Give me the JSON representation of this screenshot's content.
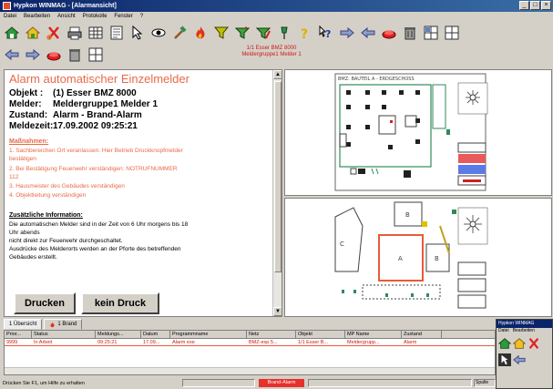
{
  "window": {
    "title": "Hypkon WINMAG - [Alarmansicht]",
    "controls": [
      "_",
      "□",
      "×"
    ]
  },
  "menu": {
    "items": [
      "Datei",
      "Bearbeiten",
      "Ansicht",
      "Protokolle",
      "Fenster",
      "?"
    ]
  },
  "toolbar": {
    "icons": [
      "home-icon",
      "home-alt-icon",
      "scissors-icon",
      "printer-icon",
      "grid-icon",
      "list-icon",
      "pointer-icon",
      "eye-icon",
      "hammer-icon",
      "fire-icon",
      "filter-icon",
      "filter-up-icon",
      "filter-edit-icon",
      "pin-icon",
      "help-icon",
      "context-help-icon",
      "arrow-right-icon",
      "arrow-left-icon",
      "reset-icon",
      "trash-icon",
      "layout-icon",
      "screen-icon"
    ],
    "row2_icons": [
      "back-icon",
      "forward-icon",
      "reset-icon",
      "trash-icon",
      "layout-icon"
    ],
    "alarm_summary_line1": "1/1 Esser BMZ 8000",
    "alarm_summary_line2": "Meldergruppe1 Melder 1"
  },
  "alarm": {
    "title": "Alarm automatischer Einzelmelder",
    "fields": [
      {
        "key": "Objekt :",
        "value": "(1)  Esser BMZ 8000"
      },
      {
        "key": "Melder:",
        "value": "Meldergruppe1 Melder 1"
      },
      {
        "key": "Zustand:",
        "value": "Alarm - Brand-Alarm"
      },
      {
        "key": "Meldezeit:",
        "value": "17.09.2002 09:25:21"
      }
    ],
    "measures_heading": "Maßnahmen:",
    "measures": [
      "1. Sachbereichen Ort veranlassen. Hier Betrieb Druckknopfmelder",
      "   bestätigen",
      "2. Bei Bestätigung Feuerwehr verständigen: NOTRUFNUMMER",
      "   112",
      "3. Hausmeister des Gebäudes verständigen",
      "4. Objektleitung verständigen"
    ],
    "extra_heading": "Zusätzliche Information:",
    "extra_lines": [
      "Die automatischen Melder sind in der Zeit von 6 Uhr morgens bis 18",
      "Uhr abends",
      "nicht direkt zur Feuerwehr durchgeschaltet.",
      "Ausdrücke des Melderorts werden an der Pforte des betreffenden",
      "Gebäudes erstellt."
    ],
    "print_button": "Drucken",
    "no_print_button": "kein Druck"
  },
  "plan_top": {
    "header": "BMZ: BAUTEIL A - ERDGESCHOSS"
  },
  "plan_bottom": {
    "labels": [
      "C",
      "B",
      "A",
      "B"
    ]
  },
  "list": {
    "tabs": [
      {
        "label": "1 Übersicht",
        "count": "1"
      },
      {
        "label": "1 Brand",
        "count": "1"
      }
    ],
    "columns": [
      "Prior...",
      "Status",
      "Meldungs...",
      "Datum",
      "Programmname",
      "Netz",
      "Objekt",
      "MP Name",
      "Zustand"
    ],
    "rows": [
      [
        "9999",
        "In Arbeit",
        "09:25:21",
        "17.09...",
        "Alarm exe",
        "BMZ-esp 5...",
        "1/1 Esser B...",
        "Meldergrupp...",
        "Alarm"
      ]
    ]
  },
  "status": {
    "left_text": "Drücken Sie F1, um Hilfe zu erhalten",
    "alarm_text": "Brand-Alarm",
    "right_text": "Spalte"
  },
  "mini_window": {
    "title": "Hypkon WINMAG",
    "menu": [
      "Datei",
      "Bearbeiten"
    ]
  },
  "colors": {
    "alarm_red": "#e86a48",
    "titlebar": "#0a246a",
    "plan_green": "#2e8b57"
  }
}
